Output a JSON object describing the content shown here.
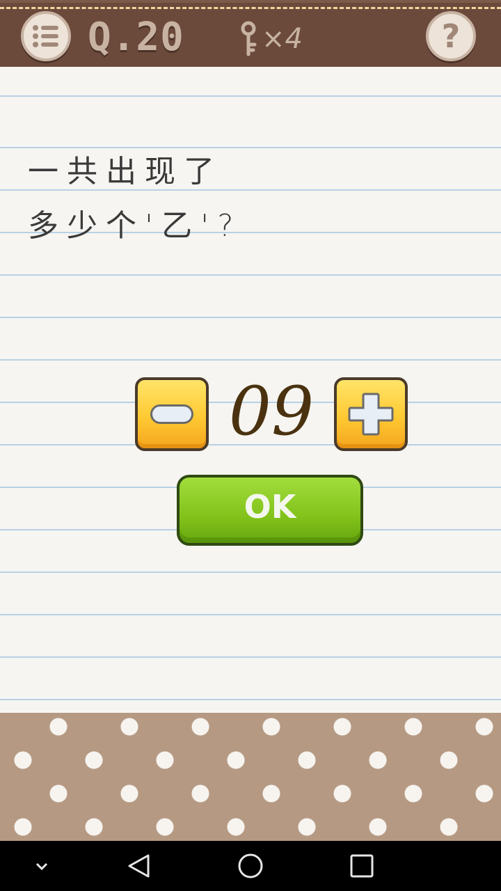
{
  "header": {
    "level_label": "Q.20",
    "key_count": "×4",
    "help_label": "?"
  },
  "question": {
    "text": "一共出现了\n多少个'乙'?"
  },
  "counter": {
    "value": "09"
  },
  "ok_button": {
    "label": "OK"
  },
  "colors": {
    "header": "#6b4a3c",
    "counter_button": "#ffc933",
    "ok_button": "#82c21b",
    "dots_panel": "#b59982",
    "ruled_line": "#b9d0e4"
  },
  "icons": {
    "menu": "list-icon",
    "key": "key-icon",
    "help": "question-mark-icon",
    "minus": "minus-icon",
    "plus": "plus-icon",
    "nav_down": "chevron-down-icon",
    "nav_back": "back-triangle-icon",
    "nav_home": "home-circle-icon",
    "nav_recents": "recents-square-icon"
  }
}
